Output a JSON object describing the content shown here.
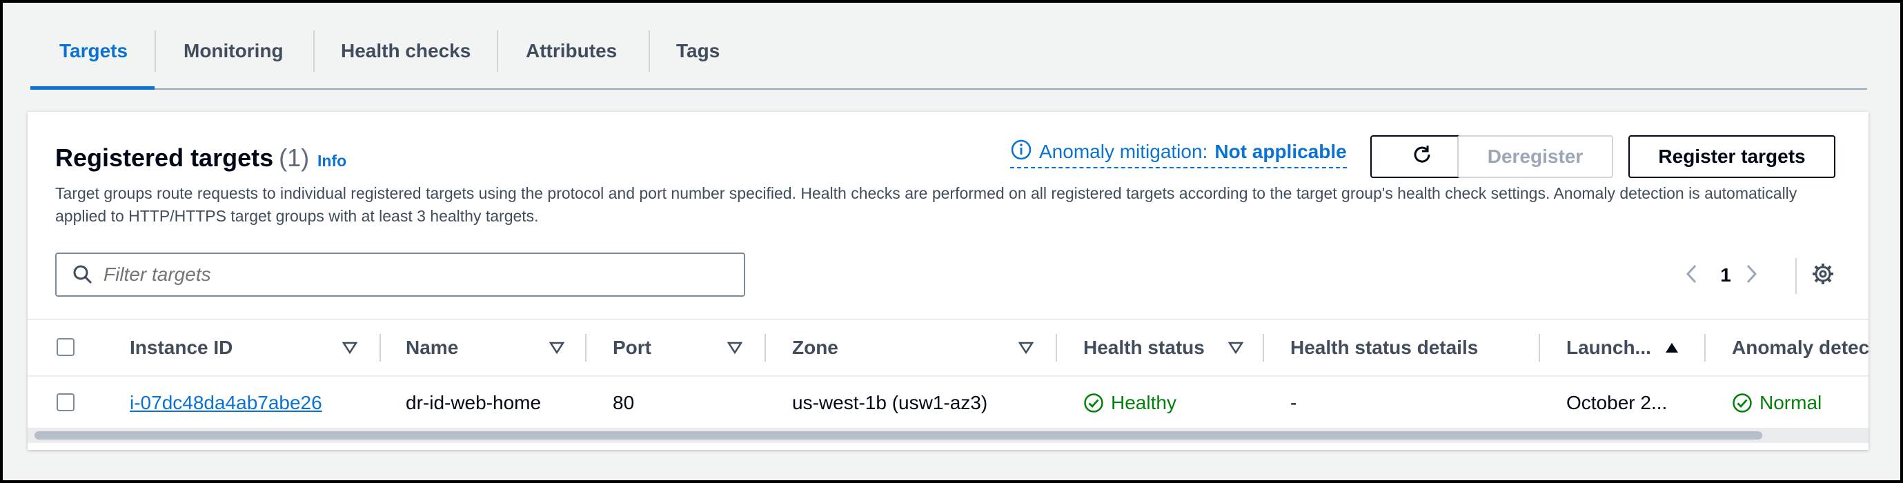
{
  "tabs": [
    {
      "label": "Targets",
      "active": true
    },
    {
      "label": "Monitoring"
    },
    {
      "label": "Health checks"
    },
    {
      "label": "Attributes"
    },
    {
      "label": "Tags"
    }
  ],
  "panel": {
    "title": "Registered targets",
    "count": "(1)",
    "info": "Info",
    "anomaly_label": "Anomaly mitigation: ",
    "anomaly_value": "Not applicable",
    "description": "Target groups route requests to individual registered targets using the protocol and port number specified. Health checks are performed on all registered targets according to the target group's health check settings. Anomaly detection is automatically applied to HTTP/HTTPS target groups with at least 3 healthy targets.",
    "buttons": {
      "deregister": "Deregister",
      "register": "Register targets"
    },
    "filter_placeholder": "Filter targets",
    "page": "1"
  },
  "table": {
    "columns": [
      "Instance ID",
      "Name",
      "Port",
      "Zone",
      "Health status",
      "Health status details",
      "Launch...",
      "Anomaly detec"
    ],
    "rows": [
      {
        "instance_id": "i-07dc48da4ab7abe26",
        "name": "dr-id-web-home",
        "port": "80",
        "zone": "us-west-1b (usw1-az3)",
        "health_status": "Healthy",
        "health_status_details": "-",
        "launch": "October 2...",
        "anomaly": "Normal"
      }
    ]
  },
  "colors": {
    "accent": "#0972d3",
    "success": "#037f0c"
  }
}
